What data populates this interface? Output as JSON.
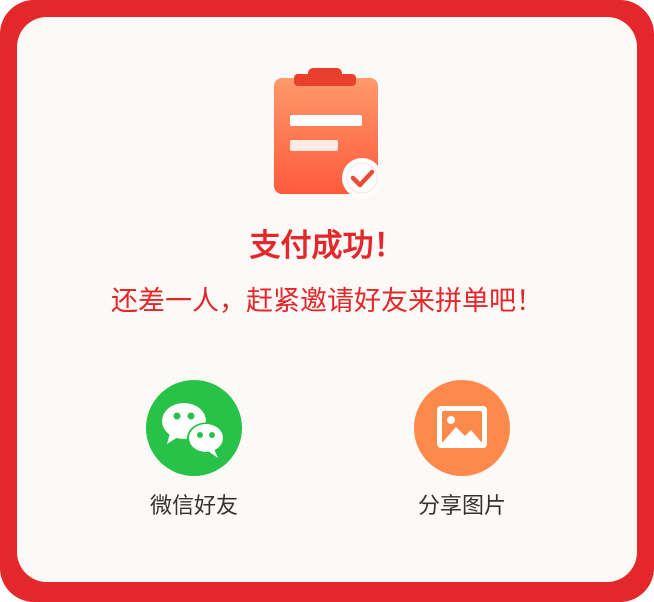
{
  "dialog": {
    "title": "支付成功！",
    "subtitle": "还差一人，赶紧邀请好友来拼单吧！",
    "icon": "clipboard-check-icon"
  },
  "share_options": [
    {
      "label": "微信好友",
      "icon": "wechat-icon",
      "color": "#27c247"
    },
    {
      "label": "分享图片",
      "icon": "image-icon",
      "color": "#fd8a4b"
    }
  ],
  "colors": {
    "accent": "#e4272a",
    "card_background": "#fdf9f6"
  }
}
